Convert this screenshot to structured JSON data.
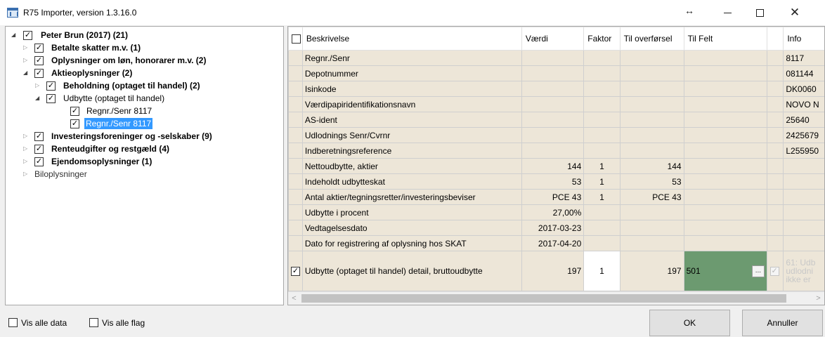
{
  "window": {
    "title": "R75 Importer, version 1.3.16.0",
    "controls": {
      "resize": "↔",
      "minimize": "minimize",
      "maximize": "maximize",
      "close": "✕"
    }
  },
  "tree": {
    "root": "Peter Brun (2017) (21)",
    "items": [
      {
        "label": "Betalte skatter m.v. (1)"
      },
      {
        "label": "Oplysninger om løn, honorarer m.v. (2)"
      },
      {
        "label": "Aktieoplysninger (2)"
      },
      {
        "label": "Beholdning (optaget til handel) (2)"
      },
      {
        "label": "Udbytte (optaget til handel)"
      },
      {
        "label": "Regnr./Senr 8117"
      },
      {
        "label": "Regnr./Senr 8117"
      },
      {
        "label": "Investeringsforeninger og -selskaber (9)"
      },
      {
        "label": "Renteudgifter og restgæld (4)"
      },
      {
        "label": "Ejendomsoplysninger (1)"
      },
      {
        "label": "Biloplysninger"
      }
    ]
  },
  "grid": {
    "headers": [
      "Beskrivelse",
      "Værdi",
      "Faktor",
      "Til overførsel",
      "Til Felt",
      "",
      "Info"
    ],
    "rows": [
      {
        "beskrivelse": "Regnr./Senr",
        "vaerdi": "",
        "faktor": "",
        "til": "",
        "felt": "",
        "info": "8117"
      },
      {
        "beskrivelse": "Depotnummer",
        "vaerdi": "",
        "faktor": "",
        "til": "",
        "felt": "",
        "info": "081144"
      },
      {
        "beskrivelse": "Isinkode",
        "vaerdi": "",
        "faktor": "",
        "til": "",
        "felt": "",
        "info": "DK0060"
      },
      {
        "beskrivelse": "Værdipapiridentifikationsnavn",
        "vaerdi": "",
        "faktor": "",
        "til": "",
        "felt": "",
        "info": "NOVO N"
      },
      {
        "beskrivelse": "AS-ident",
        "vaerdi": "",
        "faktor": "",
        "til": "",
        "felt": "",
        "info": "25640"
      },
      {
        "beskrivelse": "Udlodnings Senr/Cvrnr",
        "vaerdi": "",
        "faktor": "",
        "til": "",
        "felt": "",
        "info": "2425679"
      },
      {
        "beskrivelse": "Indberetningsreference",
        "vaerdi": "",
        "faktor": "",
        "til": "",
        "felt": "",
        "info": "L255950"
      },
      {
        "beskrivelse": "Nettoudbytte, aktier",
        "vaerdi": "144",
        "faktor": "1",
        "til": "144",
        "felt": "",
        "info": ""
      },
      {
        "beskrivelse": "Indeholdt udbytteskat",
        "vaerdi": "53",
        "faktor": "1",
        "til": "53",
        "felt": "",
        "info": ""
      },
      {
        "beskrivelse": "Antal aktier/tegningsretter/investeringsbeviser",
        "vaerdi": "PCE 43",
        "faktor": "1",
        "til": "PCE 43",
        "felt": "",
        "info": ""
      },
      {
        "beskrivelse": "Udbytte i procent",
        "vaerdi": "27,00%",
        "faktor": "",
        "til": "",
        "felt": "",
        "info": ""
      },
      {
        "beskrivelse": "Vedtagelsesdato",
        "vaerdi": "2017-03-23",
        "faktor": "",
        "til": "",
        "felt": "",
        "info": ""
      },
      {
        "beskrivelse": "Dato for registrering af oplysning hos SKAT",
        "vaerdi": "2017-04-20",
        "faktor": "",
        "til": "",
        "felt": "",
        "info": ""
      }
    ],
    "detail_row": {
      "beskrivelse": "Udbytte (optaget til handel) detail, bruttoudbytte",
      "vaerdi": "197",
      "faktor": "1",
      "til": "197",
      "felt": "501",
      "felt_button": "...",
      "info": "61: Udb udlodni ikke er"
    },
    "scroll_left": "<",
    "scroll_right": ">"
  },
  "bottom": {
    "vis_alle_data": "Vis alle data",
    "vis_alle_flag": "Vis alle flag",
    "ok": "OK",
    "annuller": "Annuller"
  },
  "colors": {
    "selection": "#3399ff",
    "row_bg": "#ede6d8",
    "felt_green": "#6c9a70"
  }
}
